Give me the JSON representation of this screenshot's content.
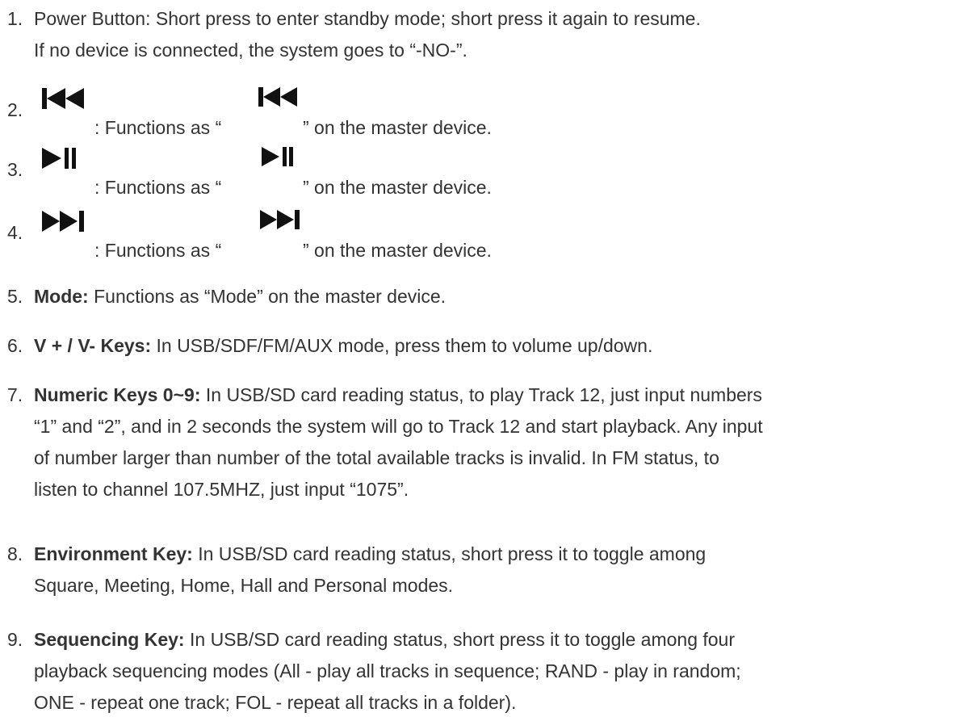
{
  "items": [
    {
      "number": "1.",
      "lines": [
        "Power Button: Short press to enter standby mode; short press it again to resume.",
        "If no device is connected, the system goes to “-NO-”."
      ]
    },
    {
      "number": "2.",
      "icon": "skip-previous-icon",
      "prefix": ": Functions as “",
      "suffix": "” on the master device."
    },
    {
      "number": "3.",
      "icon": "play-pause-icon",
      "prefix": ": Functions as “",
      "suffix": "” on the master device."
    },
    {
      "number": "4.",
      "icon": "skip-next-icon",
      "prefix": ": Functions as “",
      "suffix": "” on the master device."
    },
    {
      "number": "5.",
      "bold": "Mode:",
      "text": " Functions as “Mode” on the master device."
    },
    {
      "number": "6.",
      "bold": "V + / V- Keys:",
      "text": " In USB/SDF/FM/AUX mode, press them to volume up/down."
    },
    {
      "number": "7.",
      "bold": "Numeric Keys 0~9:",
      "text": " In USB/SD card reading status, to play Track 12, just input numbers",
      "lines": [
        "“1” and “2”, and in 2 seconds the system will go to Track 12 and start playback. Any input",
        "of number larger than number of the total available tracks is invalid. In FM status, to",
        "listen to channel 107.5MHZ, just input “1075”."
      ]
    },
    {
      "number": "8.",
      "bold": "Environment Key:",
      "text": " In USB/SD card reading status, short press it to toggle among",
      "lines": [
        "Square, Meeting, Home, Hall and Personal modes."
      ]
    },
    {
      "number": "9.",
      "bold": "Sequencing Key:",
      "text": " In USB/SD card reading status, short press it to toggle among four",
      "lines": [
        "playback sequencing modes (All - play all tracks in sequence; RAND - play in random;",
        "ONE - repeat one track; FOL - repeat all tracks in a folder)."
      ]
    }
  ]
}
